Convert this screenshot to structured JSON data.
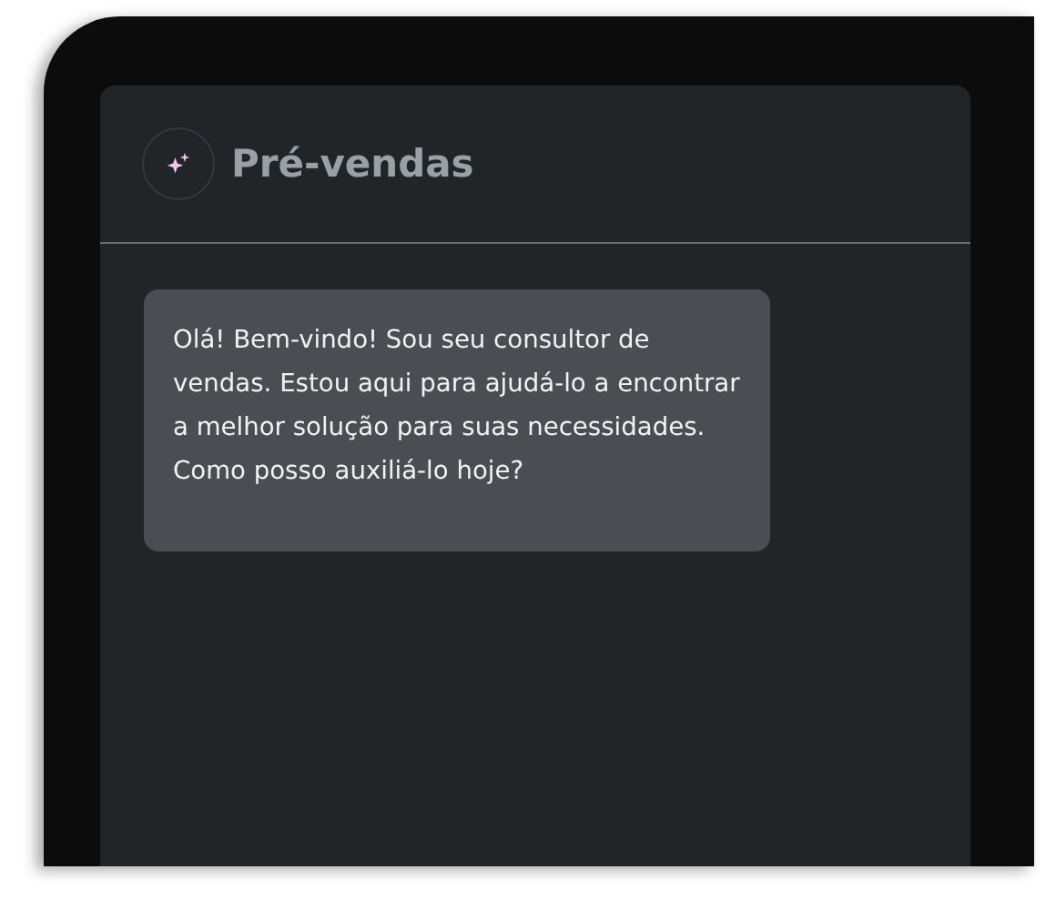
{
  "header": {
    "title": "Pré-vendas"
  },
  "messages": [
    {
      "text": "Olá! Bem-vindo! Sou seu consultor de vendas. Estou aqui para ajudá-lo a encontrar a melhor solução para suas necessidades. Como posso auxiliá-lo hoje?"
    }
  ]
}
